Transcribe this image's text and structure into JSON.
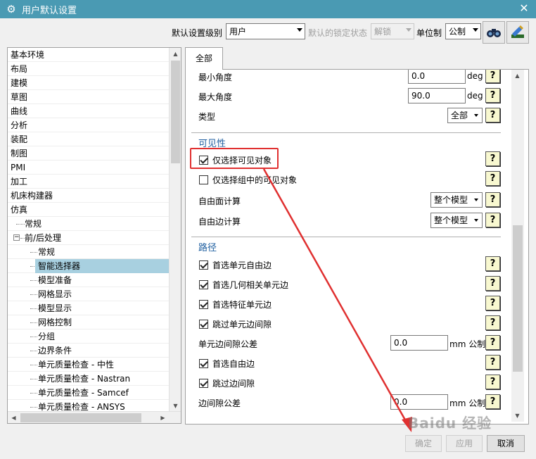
{
  "window": {
    "title": "用户默认设置",
    "close_glyph": "✕"
  },
  "topbar": {
    "level_label": "默认设置级别",
    "level_value": "用户",
    "lock_label": "默认的锁定状态",
    "lock_value": "解锁",
    "unit_label": "单位制",
    "unit_value": "公制",
    "tool1_icon": "binoculars-icon",
    "tool2_icon": "manager-icon"
  },
  "tree": {
    "items": [
      "基本环境",
      "布局",
      "建模",
      "草图",
      "曲线",
      "分析",
      "装配",
      "制图",
      "PMI",
      "加工",
      "机床构建器",
      "仿真",
      "常规",
      "前/后处理",
      "常规",
      "智能选择器",
      "模型准备",
      "网格显示",
      "模型显示",
      "网格控制",
      "分组",
      "边界条件",
      "单元质量检查 - 中性",
      "单元质量检查 - Nastran",
      "单元质量检查 - Samcef",
      "单元质量检查 - ANSYS"
    ],
    "expander_glyph": "−"
  },
  "tabs": {
    "all": "全部"
  },
  "panel": {
    "min_angle": {
      "label": "最小角度",
      "value": "0.0",
      "unit": "deg"
    },
    "max_angle": {
      "label": "最大角度",
      "value": "90.0",
      "unit": "deg"
    },
    "type": {
      "label": "类型",
      "value": "全部"
    },
    "visibility": {
      "title": "可见性",
      "select_visible": "仅选择可见对象",
      "select_group_visible": "仅选择组中的可见对象",
      "free_face_label": "自由面计算",
      "free_face_value": "整个模型",
      "free_edge_label": "自由边计算",
      "free_edge_value": "整个模型"
    },
    "path": {
      "title": "路径",
      "pref_elem_free_edge": "首选单元自由边",
      "pref_geom_elem_edge": "首选几何相关单元边",
      "pref_feature_elem_edge": "首选特征单元边",
      "skip_elem_gap": "跳过单元边间隙",
      "elem_gap_tol_label": "单元边间隙公差",
      "elem_gap_tol_value": "0.0",
      "elem_gap_tol_unit": "mm 公制",
      "pref_free_edge": "首选自由边",
      "skip_edge_gap": "跳过边间隙",
      "edge_gap_tol_label": "边间隙公差",
      "edge_gap_tol_value": "0.0",
      "edge_gap_tol_unit": "mm 公制"
    },
    "help_glyph": "?"
  },
  "buttons": {
    "ok": "确定",
    "apply": "应用",
    "cancel": "取消"
  },
  "watermark": "Baidu 经验",
  "colors": {
    "titlebar": "#4a9ab3",
    "annotation": "#e03030",
    "selection": "#a8d0e0",
    "section": "#1f5fa0"
  }
}
